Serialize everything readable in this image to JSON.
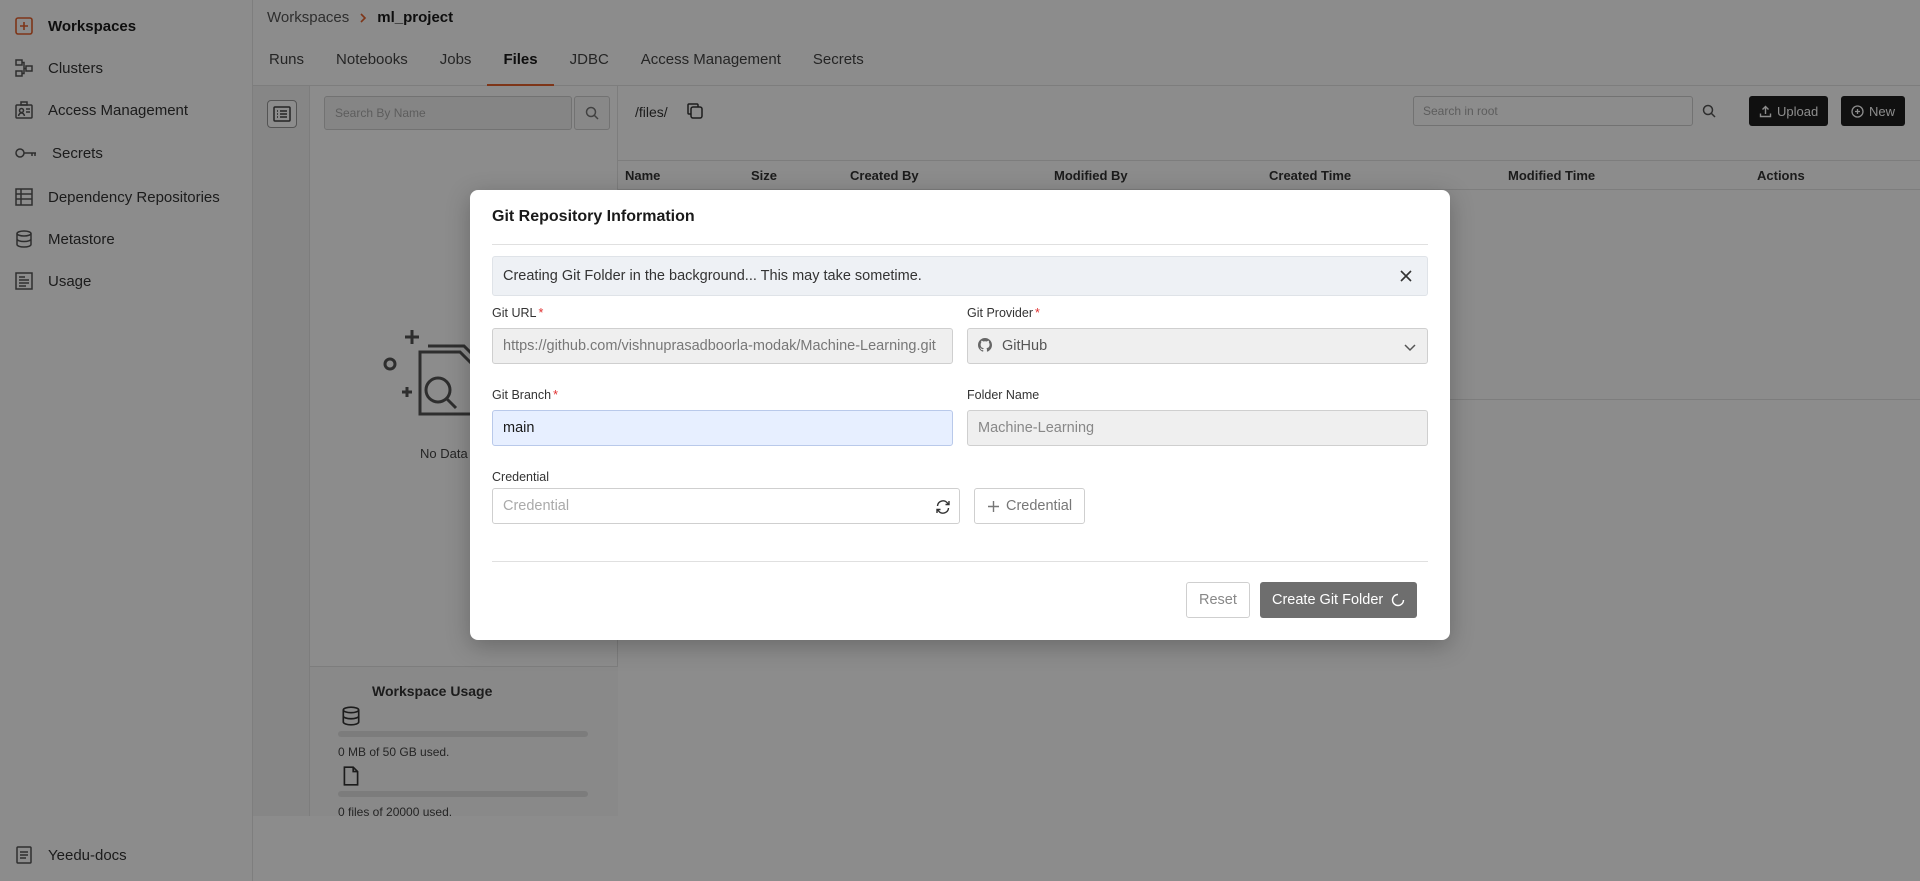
{
  "sidebar": {
    "items": [
      {
        "label": "Workspaces",
        "icon": "workspace-icon"
      },
      {
        "label": "Clusters",
        "icon": "cluster-icon"
      },
      {
        "label": "Access Management",
        "icon": "access-management-icon"
      },
      {
        "label": "Secrets",
        "icon": "key-icon"
      },
      {
        "label": "Dependency Repositories",
        "icon": "repository-icon"
      },
      {
        "label": "Metastore",
        "icon": "database-icon"
      },
      {
        "label": "Usage",
        "icon": "usage-icon"
      }
    ],
    "footer": {
      "label": "Yeedu-docs",
      "icon": "docs-icon"
    }
  },
  "header": {
    "breadcrumb": {
      "root": "Workspaces",
      "current": "ml_project"
    },
    "tabs": [
      "Runs",
      "Notebooks",
      "Jobs",
      "Files",
      "JDBC",
      "Access Management",
      "Secrets"
    ],
    "active_tab": "Files"
  },
  "files_panel": {
    "search_placeholder": "Search By Name",
    "no_data": "No Data",
    "usage": {
      "title": "Workspace Usage",
      "storage_text": "0 MB of 50 GB used.",
      "storage_fraction": 0,
      "files_text": "0 files of 20000 used.",
      "files_fraction": 0
    }
  },
  "main": {
    "path": "/files/",
    "search_placeholder": "Search in root",
    "upload_label": "Upload",
    "new_label": "New",
    "columns": [
      "Name",
      "Size",
      "Created By",
      "Modified By",
      "Created Time",
      "Modified Time",
      "Actions"
    ]
  },
  "modal": {
    "title": "Git Repository Information",
    "banner": "Creating Git Folder in the background... This may take sometime.",
    "git_url": {
      "label": "Git URL",
      "value": "https://github.com/vishnuprasadboorla-modak/Machine-Learning.git"
    },
    "git_provider": {
      "label": "Git Provider",
      "value": "GitHub"
    },
    "git_branch": {
      "label": "Git Branch",
      "value": "main"
    },
    "folder_name": {
      "label": "Folder Name",
      "placeholder": "Machine-Learning"
    },
    "credential": {
      "label": "Credential",
      "placeholder": "Credential"
    },
    "add_credential_label": "Credential",
    "reset_label": "Reset",
    "submit_label": "Create Git Folder"
  },
  "colors": {
    "accent": "#e5622c",
    "primary_disabled": "#6e6e6e"
  }
}
